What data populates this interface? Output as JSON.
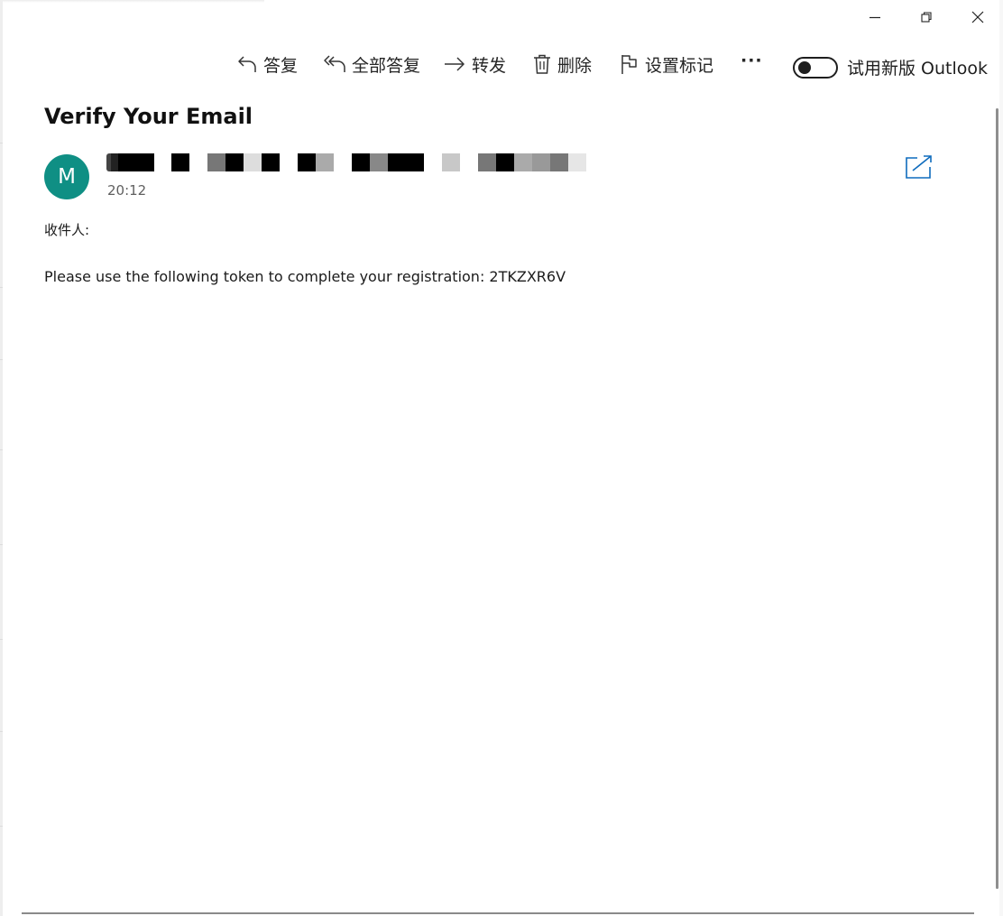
{
  "window": {
    "minimize_icon": "minimize-icon",
    "restore_icon": "restore-icon",
    "close_icon": "close-icon"
  },
  "toolbar": {
    "reply_label": "答复",
    "reply_all_label": "全部答复",
    "forward_label": "转发",
    "delete_label": "删除",
    "flag_label": "设置标记",
    "more_label": "···",
    "new_outlook_toggle": {
      "label": "试用新版 Outlook",
      "state": "off"
    }
  },
  "message": {
    "subject": "Verify Your Email",
    "avatar_initial": "M",
    "avatar_color": "#0f8f84",
    "sender": "[redacted]",
    "time": "20:12",
    "to_label": "收件人:",
    "body": "Please use the following token to complete your registration: 2TKZXR6V",
    "popout_icon": "open-in-new-window-icon"
  },
  "colors": {
    "accent": "#0f6cbd",
    "avatar": "#0f8f84",
    "text": "#1b1b1b"
  }
}
